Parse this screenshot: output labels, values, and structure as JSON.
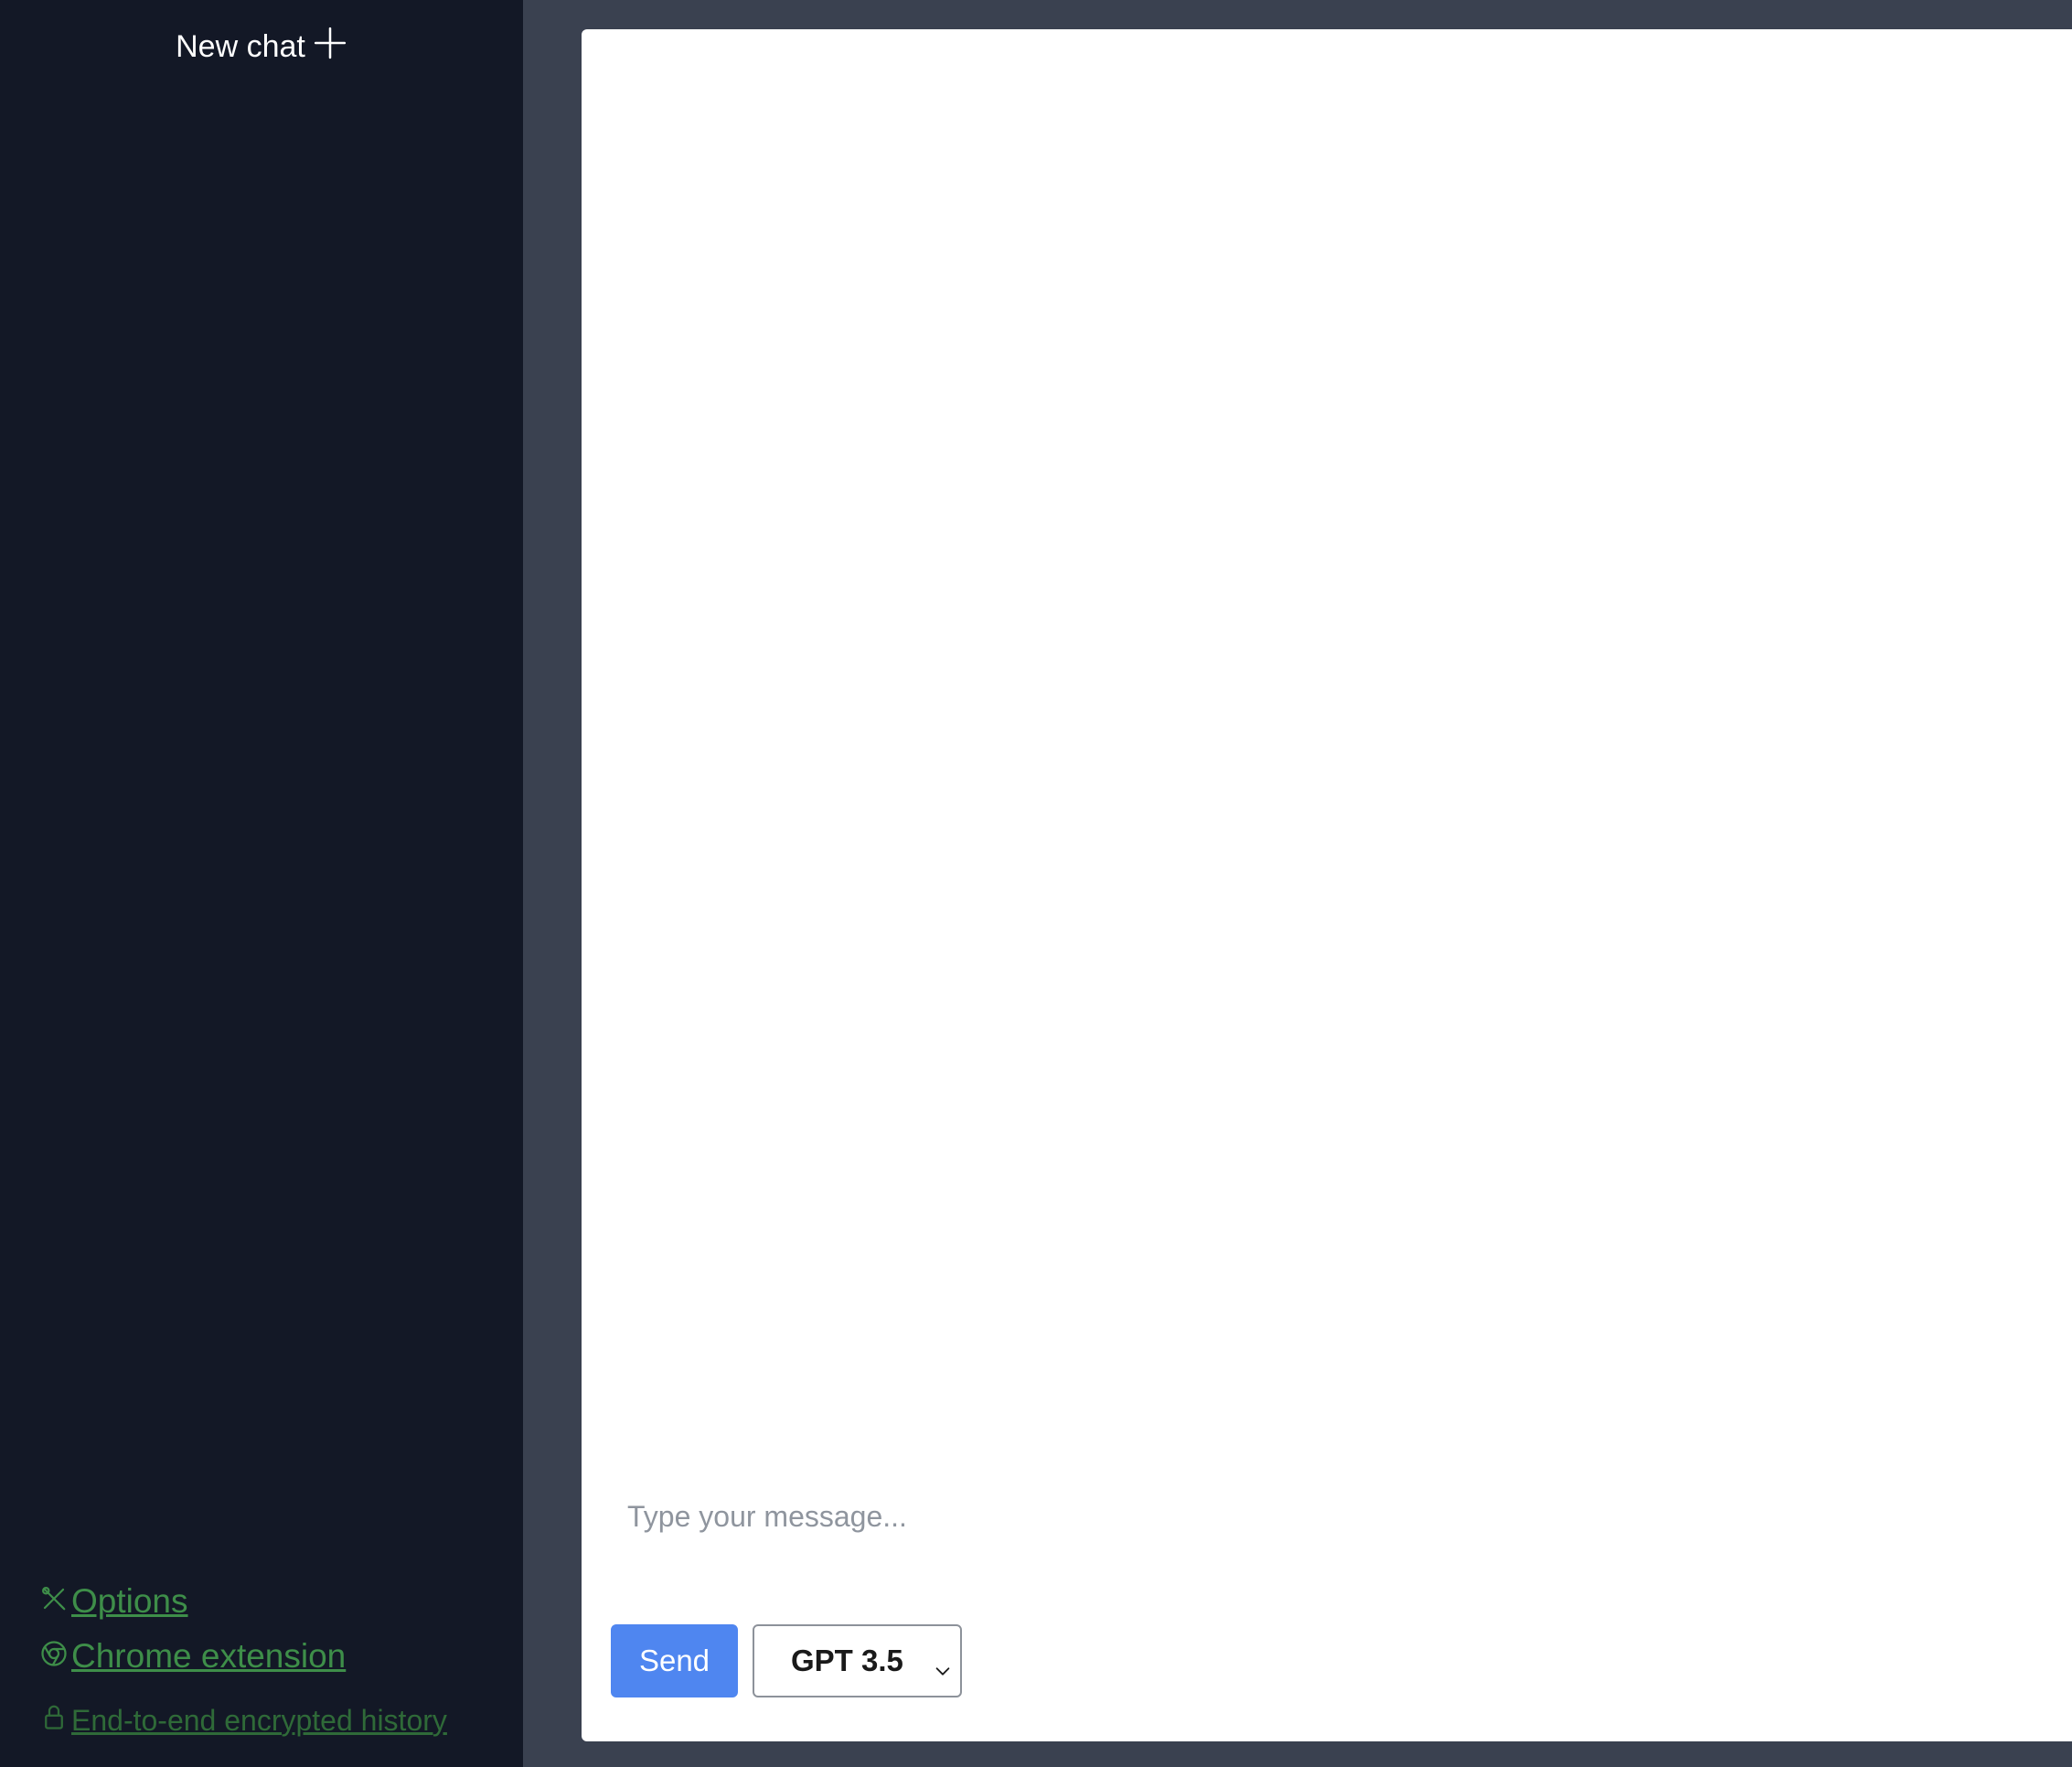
{
  "sidebar": {
    "new_chat_label": "New chat",
    "links": {
      "options": "Options",
      "chrome_extension": "Chrome extension",
      "encrypted_history": "End-to-end encrypted history"
    }
  },
  "composer": {
    "input_placeholder": "Type your message...",
    "input_value": "",
    "send_label": "Send",
    "model_selected": "GPT 3.5"
  },
  "colors": {
    "sidebar_bg": "#131826",
    "page_bg": "#3a4150",
    "link_green": "#3e8e49",
    "send_blue": "#4f86f0"
  },
  "icons": [
    "plus-icon",
    "tools-icon",
    "chrome-icon",
    "lock-icon",
    "chevron-down-icon"
  ]
}
